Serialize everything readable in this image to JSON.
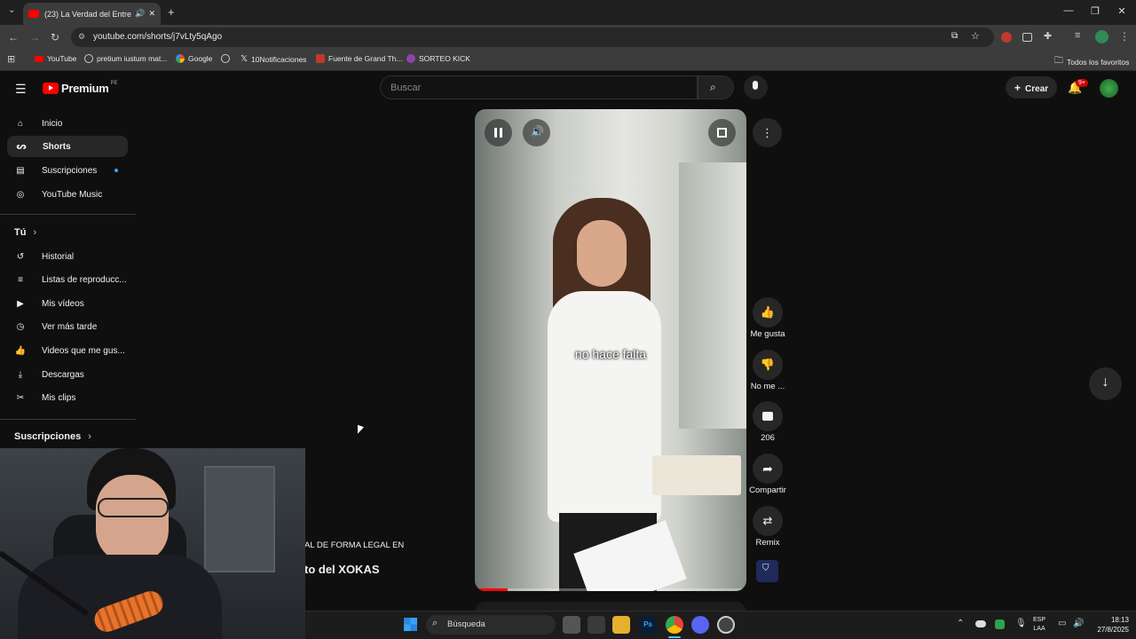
{
  "browser": {
    "tab_title": "(23) La Verdad del Entrena...",
    "url": "youtube.com/shorts/j7vLty5qAgo",
    "bookmarks": [
      "YouTube",
      "pretium iustum mat...",
      "Google",
      "10Notificaciones",
      "Fuente de Grand Th...",
      "SORTEO KICK"
    ],
    "all_bookmarks": "Todos los favoritos"
  },
  "header": {
    "logo": "Premium",
    "region": "PE",
    "search_placeholder": "Buscar",
    "create": "Crear",
    "notif_count": "9+"
  },
  "sidebar": {
    "main": [
      "Inicio",
      "Shorts",
      "Suscripciones",
      "YouTube Music"
    ],
    "you_heading": "Tú",
    "you_items": [
      "Historial",
      "Listas de reproducc...",
      "Mis vídeos",
      "Ver más tarde",
      "Videos que me gus...",
      "Descargas",
      "Mis clips"
    ],
    "subs_heading": "Suscripciones"
  },
  "video": {
    "caption": "no hace falta",
    "overlay_line1": "AL DE FORMA LEGAL EN",
    "overlay_line2": "to del XOKAS"
  },
  "actions": {
    "like": "Me gusta",
    "dislike": "No me ...",
    "comments": "206",
    "share": "Compartir",
    "remix": "Remix"
  },
  "taskbar": {
    "search": "Búsqueda",
    "lang1": "ESP",
    "lang2": "LAA",
    "time": "18:13",
    "date": "27/8/2025"
  },
  "colors": {
    "brand_red": "#ff0000",
    "bg": "#0f0f0f"
  }
}
